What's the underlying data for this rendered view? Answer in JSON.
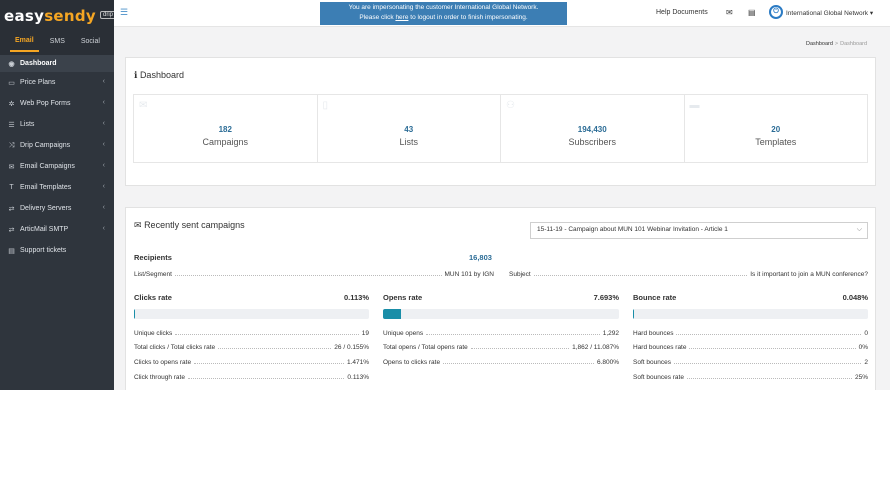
{
  "brand": {
    "logo_easy": "easy",
    "logo_sendy": "sendy",
    "logo_badge": "drip"
  },
  "colors": {
    "sidebar_bg": "#2f353d",
    "accent_orange": "#f5a623",
    "link_blue": "#2b6c96",
    "banner_blue": "#3c7eb4",
    "progress_teal": "#1a8ea8"
  },
  "channel_tabs": [
    {
      "label": "Email",
      "active": true
    },
    {
      "label": "SMS",
      "active": false
    },
    {
      "label": "Social",
      "active": false
    }
  ],
  "nav": [
    {
      "label": "Dashboard",
      "icon": "dashboard-icon"
    },
    {
      "label": "Price Plans",
      "icon": "credit-card-icon"
    },
    {
      "label": "Web Pop Forms",
      "icon": "gear-icon"
    },
    {
      "label": "Lists",
      "icon": "list-icon"
    },
    {
      "label": "Drip Campaigns",
      "icon": "shuffle-icon"
    },
    {
      "label": "Email Campaigns",
      "icon": "envelope-icon"
    },
    {
      "label": "Email Templates",
      "icon": "text-icon"
    },
    {
      "label": "Delivery Servers",
      "icon": "exchange-icon"
    },
    {
      "label": "ArticMail SMTP",
      "icon": "exchange-icon"
    },
    {
      "label": "Support tickets",
      "icon": "ticket-icon"
    }
  ],
  "topbar": {
    "banner_line1": "You are impersonating the customer International Global Network.",
    "banner_line2_pre": "Please click ",
    "banner_link": "here",
    "banner_line2_post": " to logout in order to finish impersonating.",
    "help_docs": "Help Documents",
    "account_name": "International Global Network",
    "account_caret": "▾"
  },
  "breadcrumb": {
    "root": "Dashboard",
    "separator": ">",
    "current": "Dashboard"
  },
  "dashboard": {
    "title": "Dashboard",
    "stats": [
      {
        "value": "182",
        "label": "Campaigns",
        "icon": "envelope-icon"
      },
      {
        "value": "43",
        "label": "Lists",
        "icon": "clipboard-icon"
      },
      {
        "value": "194,430",
        "label": "Subscribers",
        "icon": "users-icon"
      },
      {
        "value": "20",
        "label": "Templates",
        "icon": "template-icon"
      }
    ]
  },
  "recent": {
    "title": "Recently sent campaigns",
    "selected_campaign": "15-11-19 - Campaign about MUN 101 Webinar Invitation - Article 1",
    "recipients_label": "Recipients",
    "recipients_value": "16,803",
    "list_segment_label": "List/Segment",
    "list_segment_value": "MUN 101 by IGN",
    "subject_label": "Subject",
    "subject_value": "Is it important to join a MUN conference?",
    "clicks": {
      "title": "Clicks rate",
      "rate": "0.113%",
      "progress": 0.00113,
      "rows": [
        {
          "label": "Unique clicks",
          "value": "19"
        },
        {
          "label": "Total clicks / Total clicks rate",
          "value": "26 / 0.155%"
        },
        {
          "label": "Clicks to opens rate",
          "value": "1.471%"
        },
        {
          "label": "Click through rate",
          "value": "0.113%"
        }
      ]
    },
    "opens": {
      "title": "Opens rate",
      "rate": "7.693%",
      "progress": 0.07693,
      "rows": [
        {
          "label": "Unique opens",
          "value": "1,292"
        },
        {
          "label": "Total opens / Total opens rate",
          "value": "1,862 / 11.087%"
        },
        {
          "label": "Opens to clicks rate",
          "value": "6.800%"
        }
      ]
    },
    "bounce": {
      "title": "Bounce rate",
      "rate": "0.048%",
      "progress": 0.00048,
      "rows": [
        {
          "label": "Hard bounces",
          "value": "0"
        },
        {
          "label": "Hard bounces rate",
          "value": "0%"
        },
        {
          "label": "Soft bounces",
          "value": "2"
        },
        {
          "label": "Soft bounces rate",
          "value": "25%"
        }
      ]
    }
  }
}
